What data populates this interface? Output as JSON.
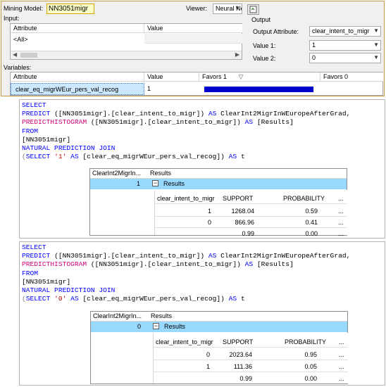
{
  "viewer": {
    "mining_model_label": "Mining Model:",
    "mining_model_value": "NN3051migr",
    "viewer_label": "Viewer:",
    "viewer_value": "Neural Net",
    "input_label": "Input:",
    "input_headers": [
      "Attribute",
      "Value"
    ],
    "input_row": "<All>",
    "output_label": "Output",
    "output_attribute_label": "Output Attribute:",
    "output_attribute_value": "clear_intent_to_migr",
    "value1_label": "Value 1:",
    "value1_value": "1",
    "value2_label": "Value 2:",
    "value2_value": "0",
    "variables_label": "Variables:",
    "variables_headers": [
      "Attribute",
      "Value",
      "Favors 1",
      "Favors 0"
    ],
    "variables_row": {
      "attribute": "clear_eq_migrWEur_pers_val_recog",
      "value": "1"
    },
    "favors_bar_color": "#0000cc",
    "favors_bar_fraction": 0.9
  },
  "queries": [
    {
      "lines": [
        [
          {
            "t": "SELECT",
            "c": "kw"
          }
        ],
        [
          {
            "t": "PREDICT",
            "c": "kw"
          },
          {
            "t": " ([NN3051migr].[clear_intent_to_migr]) ",
            "c": ""
          },
          {
            "t": "AS",
            "c": "kw"
          },
          {
            "t": " ClearInt2MigrInWEuropeAfterGrad,",
            "c": ""
          }
        ],
        [
          {
            "t": "PREDICTHISTOGRAM",
            "c": "fn"
          },
          {
            "t": " ([NN3051migr].[clear_intent_to_migr]) ",
            "c": ""
          },
          {
            "t": "AS",
            "c": "kw"
          },
          {
            "t": " [Results]",
            "c": ""
          }
        ],
        [
          {
            "t": "FROM",
            "c": "kw"
          }
        ],
        [
          {
            "t": "[NN3051migr]",
            "c": ""
          }
        ],
        [
          {
            "t": "NATURAL PREDICTION JOIN",
            "c": "kw"
          }
        ],
        [
          {
            "t": "(",
            "c": "op"
          },
          {
            "t": "SELECT",
            "c": "kw"
          },
          {
            "t": " ",
            "c": ""
          },
          {
            "t": "'1'",
            "c": "str"
          },
          {
            "t": " ",
            "c": ""
          },
          {
            "t": "AS",
            "c": "kw"
          },
          {
            "t": " [clear_eq_migrWEur_pers_val_recog]) ",
            "c": ""
          },
          {
            "t": "AS",
            "c": "kw"
          },
          {
            "t": " t",
            "c": ""
          }
        ]
      ],
      "result": {
        "headers": [
          "ClearInt2MigrIn...",
          "Results"
        ],
        "row_value": "1",
        "results_label": "Results",
        "nested_headers": [
          "clear_intent_to_migr",
          "SUPPORT",
          "PROBABILITY",
          "..."
        ],
        "nested_rows": [
          [
            "1",
            "1268.04",
            "0.59",
            "..."
          ],
          [
            "0",
            "866.96",
            "0.41",
            "..."
          ],
          [
            "",
            "0.99",
            "0.00",
            "..."
          ]
        ]
      }
    },
    {
      "lines": [
        [
          {
            "t": "SELECT",
            "c": "kw"
          }
        ],
        [
          {
            "t": "PREDICT",
            "c": "kw"
          },
          {
            "t": " ([NN3051migr].[clear_intent_to_migr]) ",
            "c": ""
          },
          {
            "t": "AS",
            "c": "kw"
          },
          {
            "t": " ClearInt2MigrInWEuropeAfterGrad,",
            "c": ""
          }
        ],
        [
          {
            "t": "PREDICTHISTOGRAM",
            "c": "fn"
          },
          {
            "t": " ([NN3051migr].[clear_intent_to_migr]) ",
            "c": ""
          },
          {
            "t": "AS",
            "c": "kw"
          },
          {
            "t": " [Results]",
            "c": ""
          }
        ],
        [
          {
            "t": "FROM",
            "c": "kw"
          }
        ],
        [
          {
            "t": "[NN3051migr]",
            "c": ""
          }
        ],
        [
          {
            "t": "NATURAL PREDICTION JOIN",
            "c": "kw"
          }
        ],
        [
          {
            "t": "(",
            "c": "op"
          },
          {
            "t": "SELECT",
            "c": "kw"
          },
          {
            "t": " ",
            "c": ""
          },
          {
            "t": "'0'",
            "c": "str"
          },
          {
            "t": " ",
            "c": ""
          },
          {
            "t": "AS",
            "c": "kw"
          },
          {
            "t": " [clear_eq_migrWEur_pers_val_recog]) ",
            "c": ""
          },
          {
            "t": "AS",
            "c": "kw"
          },
          {
            "t": " t",
            "c": ""
          }
        ]
      ],
      "result": {
        "headers": [
          "ClearInt2MigrIn...",
          "Results"
        ],
        "row_value": "0",
        "results_label": "Results",
        "nested_headers": [
          "clear_intent_to_migr",
          "SUPPORT",
          "PROBABILITY",
          "..."
        ],
        "nested_rows": [
          [
            "0",
            "2023.64",
            "0.95",
            "..."
          ],
          [
            "1",
            "111.36",
            "0.05",
            "..."
          ],
          [
            "",
            "0.99",
            "0.00",
            "..."
          ]
        ]
      }
    }
  ]
}
